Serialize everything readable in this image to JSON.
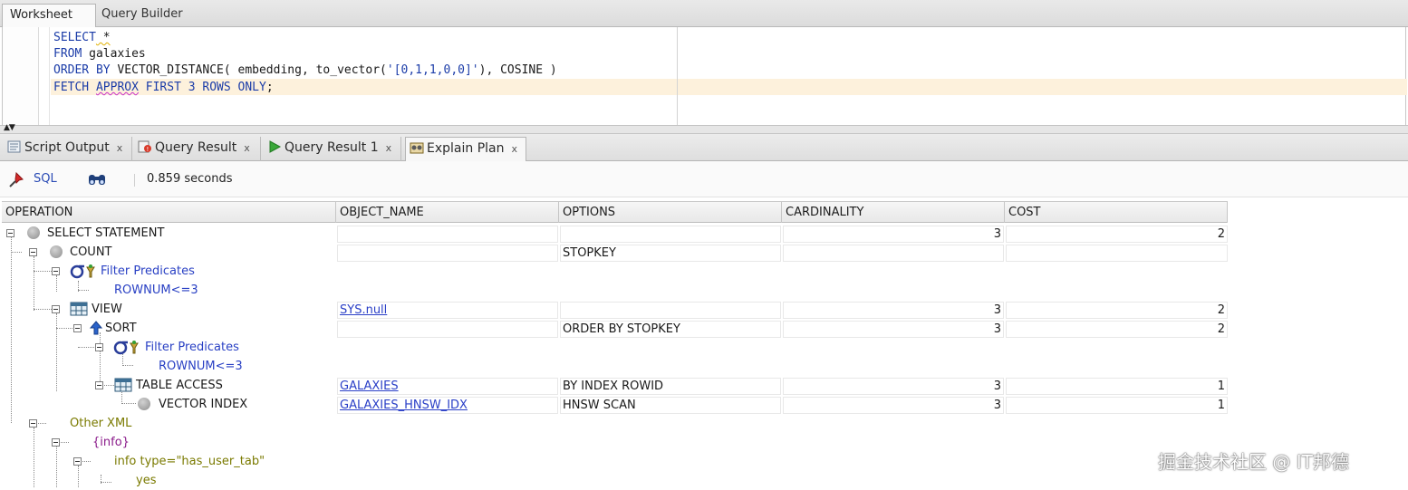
{
  "editor_tabs": [
    "Worksheet",
    "Query Builder"
  ],
  "sql_lines": {
    "l1_kw": "SELECT",
    "l1_rest": " *",
    "l2_kw": "FROM",
    "l2_rest": " galaxies",
    "l3_kw1": "ORDER BY",
    "l3_mid": " VECTOR_DISTANCE( embedding, to_vector(",
    "l3_str": "'[0,1,1,0,0]'",
    "l3_end": "), COSINE )",
    "l4_kw1": "FETCH",
    "l4_kw2": "APPROX",
    "l4_kw3": "FIRST",
    "l4_num": "3",
    "l4_kw4": "ROWS ONLY",
    "l4_end": ";"
  },
  "result_tabs": [
    {
      "label": "Script Output",
      "close": "x",
      "icon": "script-icon"
    },
    {
      "label": "Query Result",
      "close": "x",
      "icon": "query-result-icon"
    },
    {
      "label": "Query Result 1",
      "close": "x",
      "icon": "run-icon"
    },
    {
      "label": "Explain Plan",
      "close": "x",
      "icon": "explain-plan-icon",
      "active": true
    }
  ],
  "toolbar": {
    "sql_label": "SQL",
    "elapsed": "0.859 seconds"
  },
  "columns": [
    "OPERATION",
    "OBJECT_NAME",
    "OPTIONS",
    "CARDINALITY",
    "COST"
  ],
  "plan_rows": [
    {
      "operation": "SELECT STATEMENT",
      "object_name": "",
      "options": "",
      "cardinality": "3",
      "cost": "2"
    },
    {
      "operation": "COUNT",
      "object_name": "",
      "options": "STOPKEY",
      "cardinality": "",
      "cost": ""
    },
    {
      "operation": "Filter Predicates"
    },
    {
      "operation": "ROWNUM<=3"
    },
    {
      "operation": "VIEW",
      "object_name": "SYS.null",
      "options": "",
      "cardinality": "3",
      "cost": "2"
    },
    {
      "operation": "SORT",
      "object_name": "",
      "options": "ORDER BY STOPKEY",
      "cardinality": "3",
      "cost": "2"
    },
    {
      "operation": "Filter Predicates"
    },
    {
      "operation": "ROWNUM<=3"
    },
    {
      "operation": "TABLE ACCESS",
      "object_name": "GALAXIES",
      "options": "BY INDEX ROWID",
      "cardinality": "3",
      "cost": "1"
    },
    {
      "operation": "VECTOR INDEX",
      "object_name": "GALAXIES_HNSW_IDX",
      "options": "HNSW SCAN",
      "cardinality": "3",
      "cost": "1"
    },
    {
      "operation": "Other XML"
    },
    {
      "operation": "{info}"
    },
    {
      "operation": "info type=\"has_user_tab\""
    },
    {
      "operation": "yes"
    }
  ],
  "watermark": "掘金技术社区 @ IT邦德"
}
